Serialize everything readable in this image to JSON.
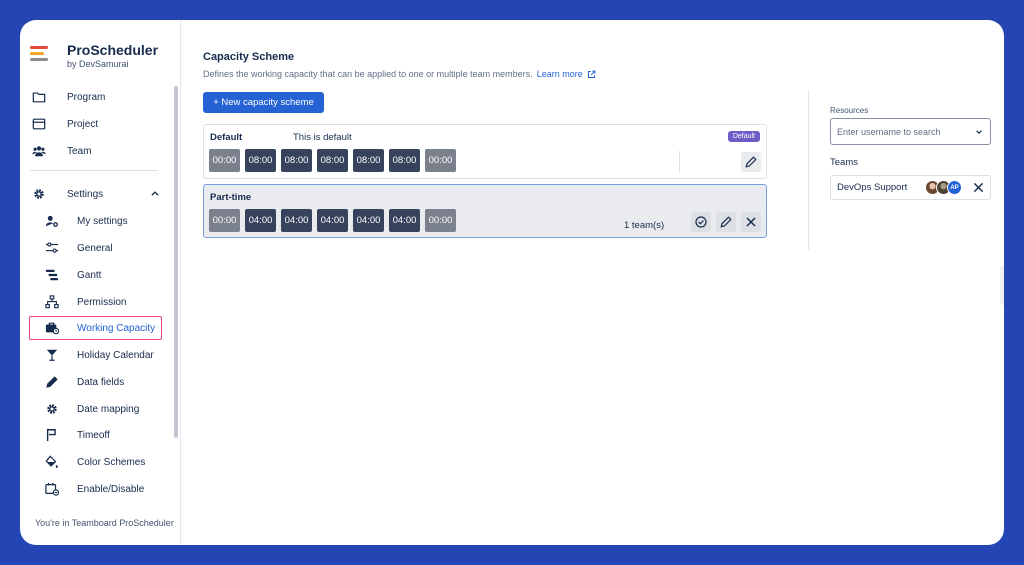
{
  "brand": {
    "name": "ProScheduler",
    "sub": "by DevSamurai",
    "logo_colors": [
      "#e5493a",
      "#f5a623",
      "#8c8c8c"
    ]
  },
  "nav": [
    {
      "label": "Program",
      "icon": "folder-icon"
    },
    {
      "label": "Project",
      "icon": "window-icon"
    },
    {
      "label": "Team",
      "icon": "team-icon"
    }
  ],
  "settings": {
    "label": "Settings",
    "expanded": true,
    "items": [
      {
        "label": "My settings",
        "icon": "user-settings-icon"
      },
      {
        "label": "General",
        "icon": "sliders-icon"
      },
      {
        "label": "Gantt",
        "icon": "gantt-icon"
      },
      {
        "label": "Permission",
        "icon": "hierarchy-icon"
      },
      {
        "label": "Working Capacity",
        "icon": "capacity-icon",
        "active": true
      },
      {
        "label": "Holiday Calendar",
        "icon": "cocktail-icon"
      },
      {
        "label": "Data fields",
        "icon": "pencil-icon"
      },
      {
        "label": "Date mapping",
        "icon": "gear-icon"
      },
      {
        "label": "Timeoff",
        "icon": "flag-icon"
      },
      {
        "label": "Color Schemes",
        "icon": "paint-bucket-icon"
      },
      {
        "label": "Enable/Disable",
        "icon": "calendar-toggle-icon"
      }
    ]
  },
  "footer": "You're in Teamboard ProScheduler",
  "page": {
    "title": "Capacity Scheme",
    "description": "Defines the working capacity that can be applied to one or multiple team members.",
    "learn_more": "Learn more",
    "new_button": "+ New capacity scheme"
  },
  "schemes": [
    {
      "name": "Default",
      "description": "This is default",
      "badge": "Default",
      "hours": [
        "00:00",
        "08:00",
        "08:00",
        "08:00",
        "08:00",
        "08:00",
        "00:00"
      ],
      "team_count": ""
    },
    {
      "name": "Part-time",
      "description": "",
      "badge": "",
      "hours": [
        "00:00",
        "04:00",
        "04:00",
        "04:00",
        "04:00",
        "04:00",
        "00:00"
      ],
      "team_count": "1 team(s)"
    }
  ],
  "resources": {
    "label": "Resources",
    "placeholder": "Enter username to search",
    "teams_label": "Teams",
    "team": {
      "name": "DevOps Support",
      "avatar_initials": "AP"
    }
  },
  "colors": {
    "accent": "#2563d4",
    "active_border": "#e5457a",
    "badge": "#6e5dc6",
    "frame": "#2446b5"
  }
}
